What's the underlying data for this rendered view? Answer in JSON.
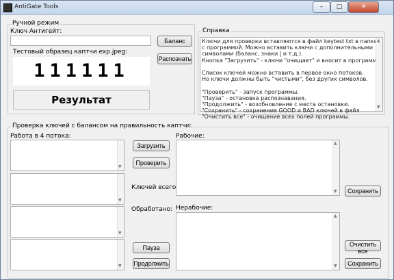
{
  "window": {
    "title": "AntiGate Tools",
    "minimize_label": "–",
    "maximize_label": "□",
    "close_label": "✕"
  },
  "manual": {
    "group_title": "Ручной режим",
    "key_label": "Ключ Антигейт:",
    "key_value": "",
    "balance_button": "Баланс",
    "recognize_button": "Распознать",
    "sample_label": "Тестовый образец каптчи exp.jpeg:",
    "captcha_text": "111111",
    "result_text": "Результат"
  },
  "help": {
    "group_title": "Справка",
    "lines": [
      "Ключи для проверки вставляются в файл keytest.txt в папке",
      "с программой. Можно вставить ключи с дополнительными",
      "символами (баланс, знаки | и т.д.).",
      "Кнопка \"Загрузить\" - ключи \"очищает\" и вносит в программу.",
      "",
      "Список ключей можно вставить в первое окно потоков.",
      "Но ключи должны быть \"чистыми\", без других символов.",
      "",
      "\"Проверить\" - запуск программы.",
      "\"Пауза\" - остановка распознавания.",
      "\"Продолжить\" - возобновление с места остановки.",
      "\"Сохранить\" - сохранение GOOD и BAD ключей в файл",
      "\"Очистить все\" - очищение всех полей программы."
    ]
  },
  "check": {
    "group_title": "Проверка ключей с балансом на правильность каптчи:",
    "threads_label": "Работа в 4 потока:",
    "working_label": "Рабочие:",
    "nonworking_label": "Нерабочие:",
    "total_keys_label": "Ключей всего:",
    "processed_label": "Обработано:",
    "load_button": "Загрузить",
    "check_button": "Проверить",
    "pause_button": "Пауза",
    "continue_button": "Продолжить",
    "save_working_button": "Сохранить",
    "clear_all_button": "Очистить все",
    "save_nonworking_button": "Сохранить"
  }
}
